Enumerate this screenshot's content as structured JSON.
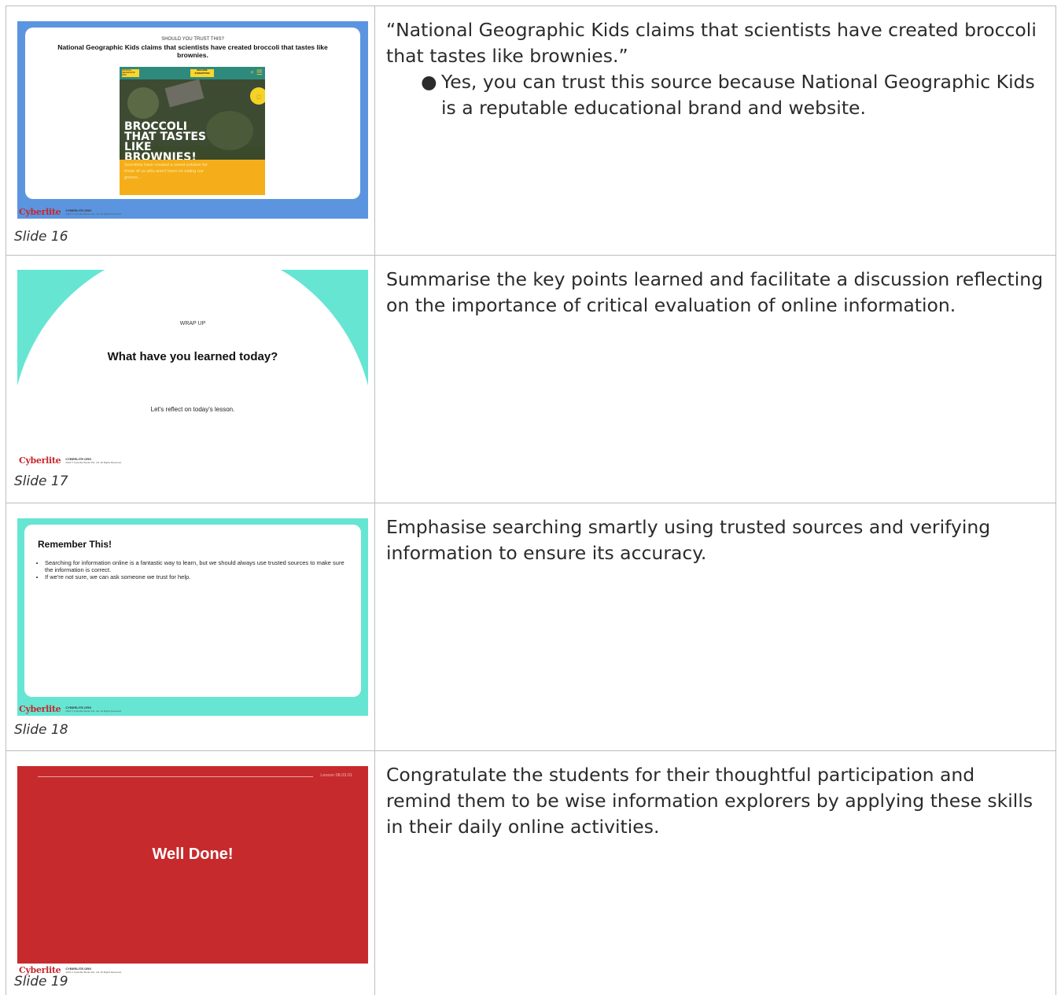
{
  "rows": [
    {
      "caption": "Slide 16",
      "note": "“National Geographic Kids claims that scientists have created broccoli that tastes like brownies.”",
      "bullet": "Yes, you can trust this source because National Geographic Kids is a reputable educational brand and website.",
      "slide": {
        "kicker": "SHOULD YOU TRUST THIS?",
        "headline": "National Geographic Kids claims that scientists have created broccoli that tastes like brownies.",
        "web": {
          "brand": "NATIONAL GEOGRAPHIC KIDS",
          "magazine_button": "MAGAZINE SUBSCRIPTION",
          "big_title": "BROCCOLI THAT TASTES LIKE BROWNIES!",
          "teaser": "Scientists have created a sweet solution for those of us who aren't keen on eating our greens…"
        }
      }
    },
    {
      "caption": "Slide 17",
      "note": "Summarise the key points learned and facilitate a discussion reflecting on the importance of critical evaluation of online information.",
      "slide": {
        "kicker": "WRAP UP",
        "title": "What have you learned today?",
        "subtitle": "Let's reflect on today's lesson."
      }
    },
    {
      "caption": "Slide 18",
      "note": "Emphasise searching smartly using trusted sources and verifying information to ensure its accuracy.",
      "slide": {
        "title": "Remember This!",
        "points": [
          "Searching for information online is a fantastic way to learn, but we should always use trusted sources to make sure the information is correct.",
          "If we're not sure, we can ask someone we trust for help."
        ]
      }
    },
    {
      "caption": "Slide 19",
      "note": "Congratulate the students for their thoughtful participation and remind them to be wise information explorers by applying these skills in their daily online activities.",
      "slide": {
        "lesson": "Lesson 08.03.01",
        "title": "Well Done!"
      }
    }
  ],
  "footer": {
    "logo": "Cyberlite",
    "site": "CYBERLITE.ORG",
    "copyright": "2024 © Cyberlite Books Pte. Ltd. All Rights Reserved."
  },
  "colors": {
    "slide16_bg": "#5b95e0",
    "slide17_bg": "#67e5d3",
    "slide18_bg": "#67e5d3",
    "slide19_bg": "#c62a2d",
    "brand_red": "#c7272d"
  }
}
